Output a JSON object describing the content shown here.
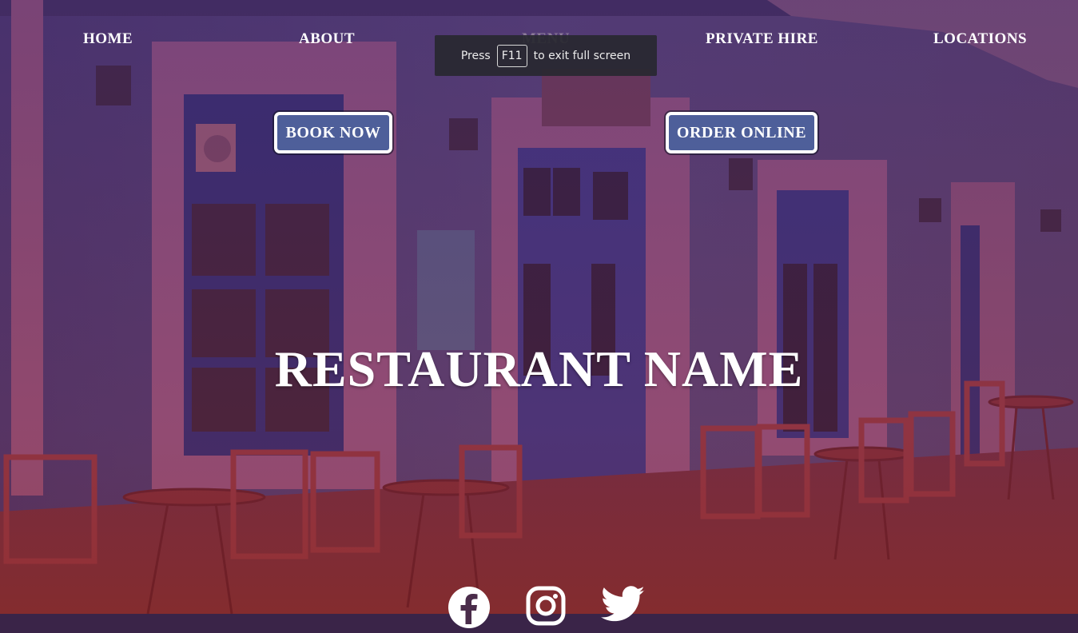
{
  "nav": {
    "items": [
      {
        "label": "HOME"
      },
      {
        "label": "ABOUT"
      },
      {
        "label": "MENU"
      },
      {
        "label": "PRIVATE HIRE"
      },
      {
        "label": "LOCATIONS"
      }
    ]
  },
  "fullscreen_toast": {
    "press": "Press",
    "key": "F11",
    "suffix": "to exit full screen"
  },
  "cta": {
    "book": "BOOK NOW",
    "order": "ORDER ONLINE"
  },
  "hero": {
    "title": "RESTAURANT NAME"
  },
  "social": {
    "icons": [
      "facebook-icon",
      "instagram-icon",
      "twitter-icon"
    ]
  },
  "colors": {
    "button_bg": "#4e5f9a",
    "button_border": "#ffffff",
    "text": "#ffffff",
    "overlay": "#5a2f6e"
  }
}
